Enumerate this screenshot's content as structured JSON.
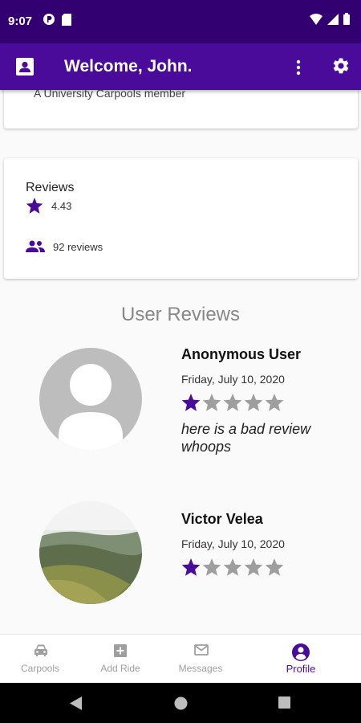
{
  "status_bar": {
    "time": "9:07"
  },
  "app_bar": {
    "title": "Welcome, John."
  },
  "profile_card": {
    "subtitle": "A University Carpools member"
  },
  "reviews_card": {
    "label": "Reviews",
    "rating": "4.43",
    "count": "92 reviews"
  },
  "section_title": "User Reviews",
  "reviews": [
    {
      "name": "Anonymous User",
      "date": "Friday, July 10, 2020",
      "stars": 1,
      "max_stars": 5,
      "text": "here is a bad review whoops"
    },
    {
      "name": "Victor Velea",
      "date": "Friday, July 10, 2020",
      "stars": 1,
      "max_stars": 5,
      "text": ""
    }
  ],
  "bottom_nav": [
    {
      "label": "Carpools",
      "icon": "car-icon",
      "active": false
    },
    {
      "label": "Add Ride",
      "icon": "add-box-icon",
      "active": false
    },
    {
      "label": "Messages",
      "icon": "mail-icon",
      "active": false
    },
    {
      "label": "Profile",
      "icon": "account-circle-icon",
      "active": true
    }
  ],
  "colors": {
    "status_bar": "#330072",
    "app_bar": "#4a0a9a",
    "accent": "#4a0a9a",
    "star_empty": "#9e9e9e"
  }
}
